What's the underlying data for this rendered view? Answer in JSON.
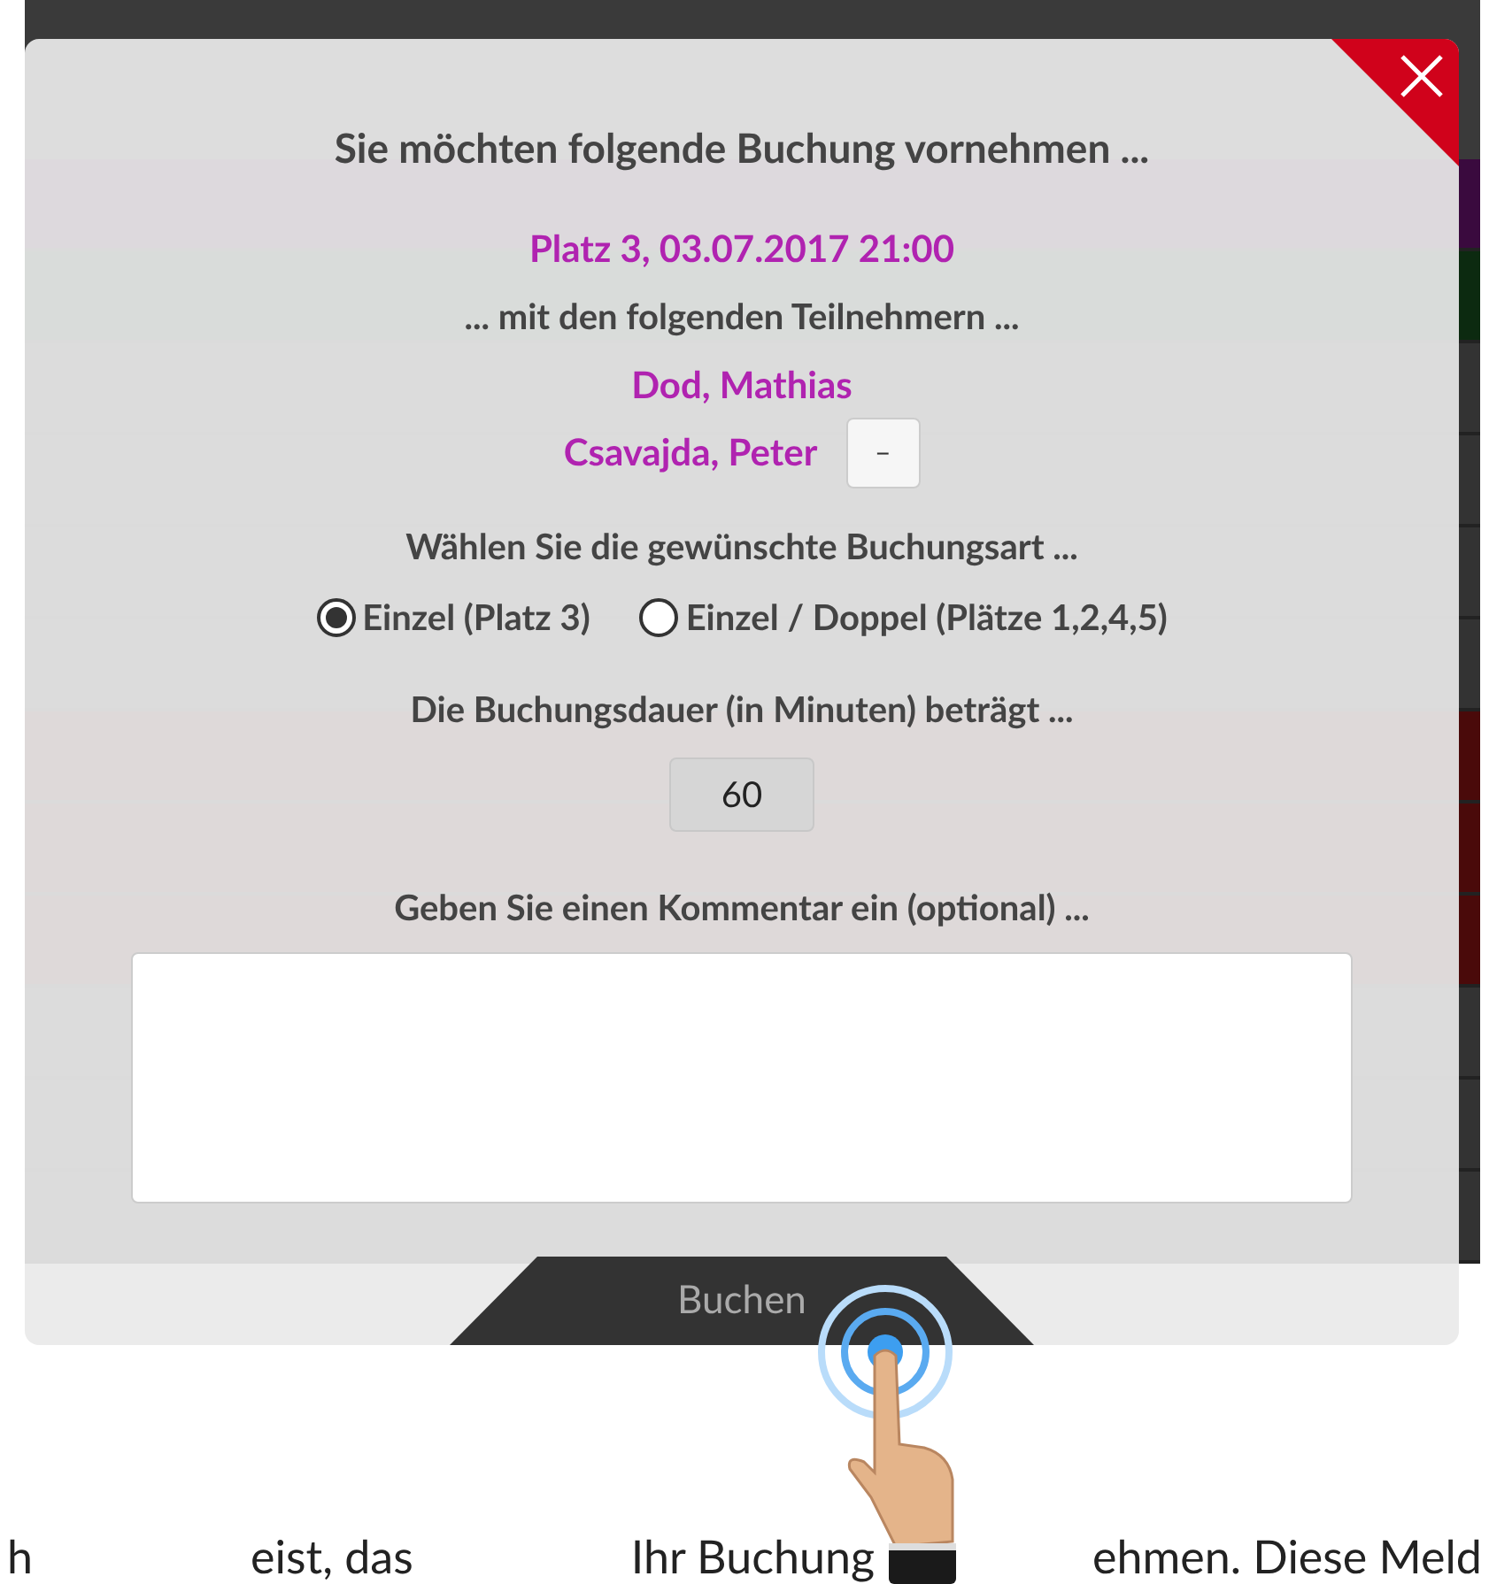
{
  "dialog": {
    "title": "Sie möchten folgende Buchung vornehmen ...",
    "booking": "Platz 3, 03.07.2017 21:00",
    "participants_label": "... mit den folgenden Teilnehmern ...",
    "participants": [
      {
        "name": "Dod, Mathias"
      },
      {
        "name": "Csavajda, Peter",
        "remove_label": "–"
      }
    ],
    "type_label": "Wählen Sie die gewünschte Buchungsart ...",
    "types": [
      {
        "label": "Einzel (Platz 3)",
        "selected": true
      },
      {
        "label": "Einzel / Doppel (Plätze 1,2,4,5)",
        "selected": false
      }
    ],
    "duration_label": "Die Buchungsdauer (in Minuten) beträgt ...",
    "duration": "60",
    "comment_label": "Geben Sie einen Kommentar ein (optional) ...",
    "submit": "Buchen"
  },
  "caption": [
    "h",
    "eist, das",
    "Ihr Buchung",
    "ehmen. Diese Meld"
  ]
}
